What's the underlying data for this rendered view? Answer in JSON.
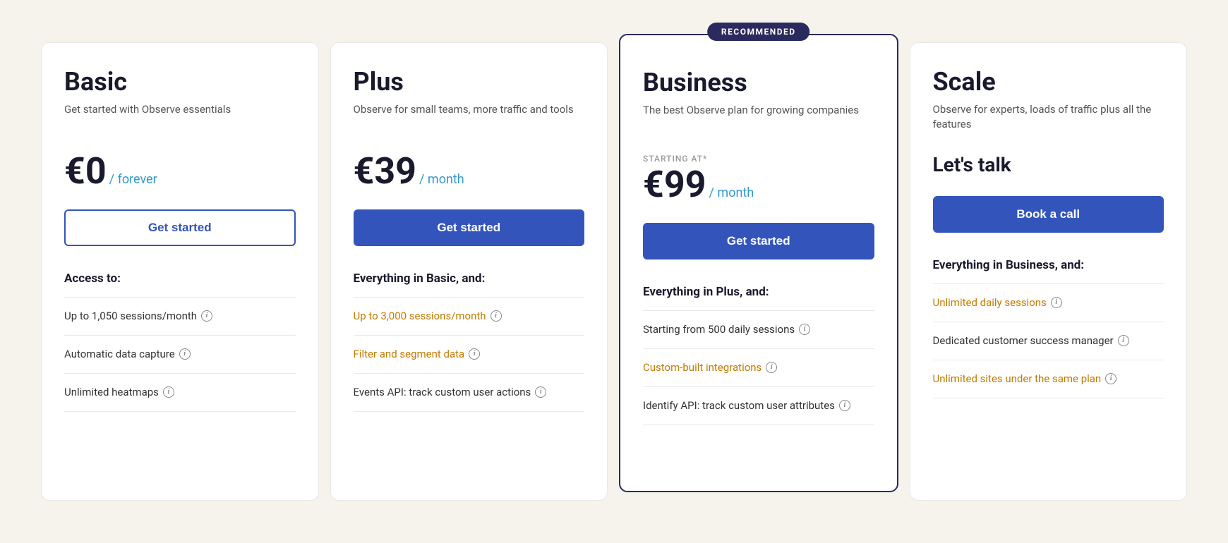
{
  "plans": [
    {
      "id": "basic",
      "name": "Basic",
      "description": "Get started with Observe essentials",
      "price": "€0",
      "price_period": "/ forever",
      "recommended": false,
      "cta_label": "Get started",
      "cta_style": "outline",
      "features_header": "Access to:",
      "features": [
        {
          "text": "Up to 1,050 sessions/month",
          "has_info": true,
          "highlight": false
        },
        {
          "text": "Automatic data capture",
          "has_info": true,
          "highlight": false
        },
        {
          "text": "Unlimited heatmaps",
          "has_info": true,
          "highlight": false
        }
      ]
    },
    {
      "id": "plus",
      "name": "Plus",
      "description": "Observe for small teams, more traffic and tools",
      "price": "€39",
      "price_period": "/ month",
      "recommended": false,
      "cta_label": "Get started",
      "cta_style": "primary",
      "features_header": "Everything in Basic, and:",
      "features": [
        {
          "text": "Up to 3,000 sessions/month",
          "has_info": true,
          "highlight": true
        },
        {
          "text": "Filter and segment data",
          "has_info": true,
          "highlight": true
        },
        {
          "text": "Events API: track custom user actions",
          "has_info": true,
          "highlight": false
        }
      ]
    },
    {
      "id": "business",
      "name": "Business",
      "description": "The best Observe plan for growing companies",
      "starting_at_label": "STARTING AT*",
      "price": "€99",
      "price_period": "/ month",
      "recommended": true,
      "recommended_badge": "RECOMMENDED",
      "cta_label": "Get started",
      "cta_style": "primary",
      "features_header": "Everything in Plus, and:",
      "features": [
        {
          "text": "Starting from 500 daily sessions",
          "has_info": true,
          "highlight": false
        },
        {
          "text": "Custom-built integrations",
          "has_info": true,
          "highlight": true
        },
        {
          "text": "Identify API: track custom user attributes",
          "has_info": true,
          "highlight": false
        }
      ]
    },
    {
      "id": "scale",
      "name": "Scale",
      "description": "Observe for experts, loads of traffic plus all the features",
      "lets_talk": "Let's talk",
      "recommended": false,
      "cta_label": "Book a call",
      "cta_style": "primary",
      "features_header": "Everything in Business, and:",
      "features": [
        {
          "text": "Unlimited daily sessions",
          "has_info": true,
          "highlight": true
        },
        {
          "text": "Dedicated customer success manager",
          "has_info": true,
          "highlight": false
        },
        {
          "text": "Unlimited sites under the same plan",
          "has_info": true,
          "highlight": true
        }
      ]
    }
  ]
}
